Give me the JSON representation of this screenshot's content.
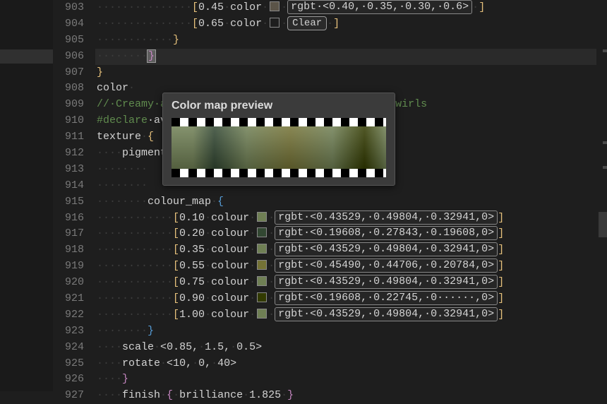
{
  "tooltip": {
    "title": "Color map preview"
  },
  "labels": {
    "clear": "Clear"
  },
  "gutter_start": 903,
  "lines": {
    "l903": {
      "indent": "···············",
      "open": "[",
      "pos": "0.45",
      "kw": "color",
      "swatch": "#5b5448",
      "rgbt": "rgbt·<0.40,·0.35,·0.30,·0.6>",
      "close": "·]"
    },
    "l904": {
      "indent": "···············",
      "open": "[",
      "pos": "0.65",
      "kw": "color",
      "close": "·]"
    },
    "l905": {
      "indent": "············",
      "brace": "}"
    },
    "l906": {
      "indent": "········",
      "brace": "}"
    },
    "l907": {
      "brace": "}"
    },
    "l908": {
      "text": "color·"
    },
    "l909": {
      "comment": "//·Creamy·avacado·with·slightly·burnt·avacado·swirls"
    },
    "l910": {
      "declare": "#declare",
      "rest": "·avacado·="
    },
    "l911": {
      "text": "texture·",
      "brace": "{"
    },
    "l912": {
      "indent": "····",
      "text": "pigment·",
      "brace": "{"
    },
    "l913": {
      "indent": "········"
    },
    "l914": {
      "indent": "········"
    },
    "l915": {
      "indent": "········",
      "text": "colour_map·",
      "brace": "{"
    },
    "entries": [
      {
        "ln": 916,
        "pos": "0.10",
        "swatch": "#6f7f54",
        "rgbt": "rgbt·<0.43529,·0.49804,·0.32941,0>"
      },
      {
        "ln": 917,
        "pos": "0.20",
        "swatch": "#324732",
        "rgbt": "rgbt·<0.19608,·0.27843,·0.19608,0>"
      },
      {
        "ln": 918,
        "pos": "0.35",
        "swatch": "#6f7f54",
        "rgbt": "rgbt·<0.43529,·0.49804,·0.32941,0>"
      },
      {
        "ln": 919,
        "pos": "0.55",
        "swatch": "#747235",
        "rgbt": "rgbt·<0.45490,·0.44706,·0.20784,0>"
      },
      {
        "ln": 920,
        "pos": "0.75",
        "swatch": "#6f7f54",
        "rgbt": "rgbt·<0.43529,·0.49804,·0.32941,0>"
      },
      {
        "ln": 921,
        "pos": "0.90",
        "swatch": "#323a00",
        "rgbt": "rgbt·<0.19608,·0.22745,·0······,0>"
      },
      {
        "ln": 922,
        "pos": "1.00",
        "swatch": "#6f7f54",
        "rgbt": "rgbt·<0.43529,·0.49804,·0.32941,0>"
      }
    ],
    "entry_indent": "············",
    "entry_kw": "colour",
    "l923": {
      "indent": "········",
      "brace": "}"
    },
    "l924": {
      "indent": "····",
      "text": "scale·<0.85,·1.5,·0.5>"
    },
    "l925": {
      "indent": "····",
      "text": "rotate·<10,·0,·40>"
    },
    "l926": {
      "indent": "····",
      "brace": "}"
    },
    "l927": {
      "indent": "····",
      "text": "finish·",
      "brace": "{",
      "tail": "·brilliance·1.825·",
      "brace2": "}"
    }
  },
  "chart_data": {
    "type": "gradient",
    "title": "Color map preview",
    "stops": [
      {
        "pos": 0.1,
        "rgb": [
          0.43529,
          0.49804,
          0.32941
        ],
        "t": 0
      },
      {
        "pos": 0.2,
        "rgb": [
          0.19608,
          0.27843,
          0.19608
        ],
        "t": 0
      },
      {
        "pos": 0.35,
        "rgb": [
          0.43529,
          0.49804,
          0.32941
        ],
        "t": 0
      },
      {
        "pos": 0.55,
        "rgb": [
          0.4549,
          0.44706,
          0.20784
        ],
        "t": 0
      },
      {
        "pos": 0.75,
        "rgb": [
          0.43529,
          0.49804,
          0.32941
        ],
        "t": 0
      },
      {
        "pos": 0.9,
        "rgb": [
          0.19608,
          0.22745,
          0.0
        ],
        "t": 0
      },
      {
        "pos": 1.0,
        "rgb": [
          0.43529,
          0.49804,
          0.32941
        ],
        "t": 0
      }
    ]
  }
}
